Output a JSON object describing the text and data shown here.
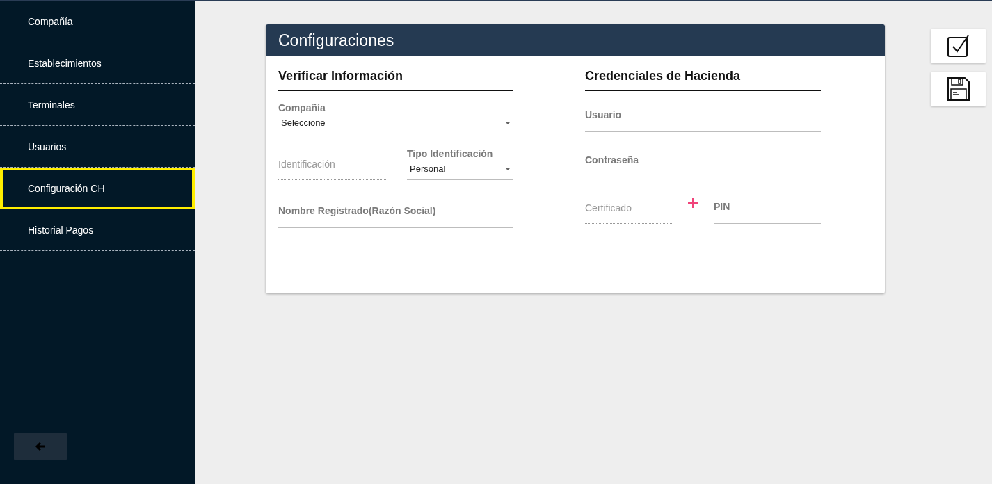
{
  "sidebar": {
    "items": [
      {
        "label": "Compañía",
        "selected": false
      },
      {
        "label": "Establecimientos",
        "selected": false
      },
      {
        "label": "Terminales",
        "selected": false
      },
      {
        "label": "Usuarios",
        "selected": false
      },
      {
        "label": "Configuración CH",
        "selected": true
      },
      {
        "label": "Historial Pagos",
        "selected": false
      }
    ]
  },
  "card": {
    "title": "Configuraciones",
    "left": {
      "heading": "Verificar Información",
      "company": {
        "label": "Compañía",
        "value": "Seleccione"
      },
      "identification": {
        "placeholder": "Identificación",
        "disabled": true
      },
      "id_type": {
        "label": "Tipo Identificación",
        "value": "Personal"
      },
      "registered_name": {
        "label": "Nombre Registrado(Razón Social)",
        "disabled": false
      }
    },
    "right": {
      "heading": "Credenciales de Hacienda",
      "user": {
        "label": "Usuario",
        "disabled": false
      },
      "password": {
        "label": "Contraseña",
        "disabled": false
      },
      "certificate": {
        "placeholder": "Certificado",
        "disabled": true
      },
      "pin": {
        "label": "PIN",
        "disabled": false
      }
    }
  }
}
